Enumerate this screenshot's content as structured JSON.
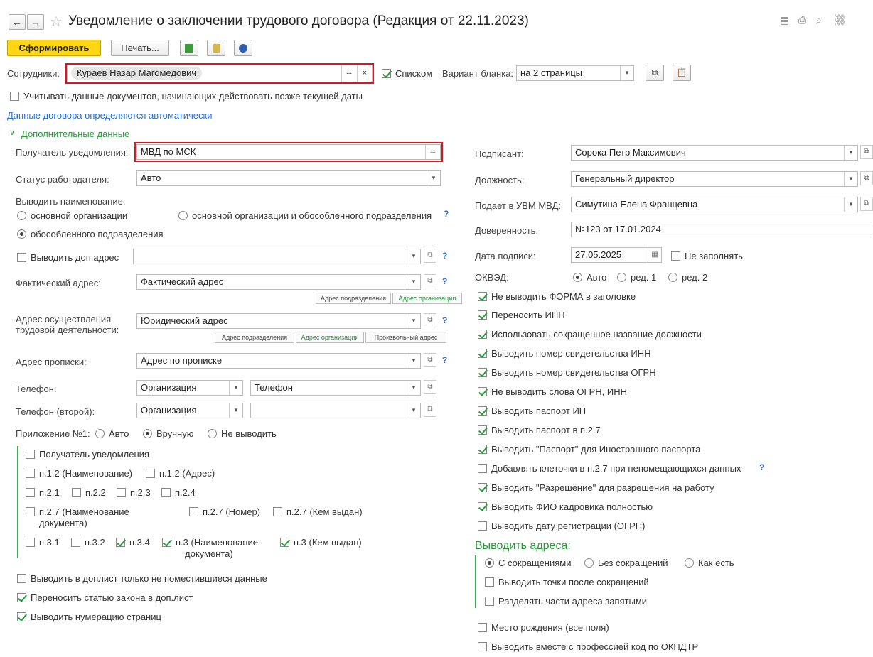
{
  "window": {
    "title": "Уведомление о заключении трудового договора (Редакция от 22.11.2023)"
  },
  "toolbar": {
    "generate_label": "Сформировать",
    "print_label": "Печать..."
  },
  "employees": {
    "label": "Сотрудники:",
    "value": "Кураев Назар Магомедович",
    "list_label": "Списком",
    "variant_label": "Вариант бланка:",
    "variant_value": "на 2 страницы"
  },
  "options": {
    "future_docs_label": "Учитывать данные документов, начинающих действовать позже текущей даты",
    "auto_link": "Данные договора определяются автоматически",
    "additional_section": "Дополнительные данные"
  },
  "left": {
    "recipient_label": "Получатель уведомления:",
    "recipient_value": "МВД по МСК",
    "employer_status_label": "Статус работодателя:",
    "employer_status_value": "Авто",
    "output_name_label": "Выводить наименование:",
    "radio_main_org": "основной организации",
    "radio_main_and_sub": "основной организации и обособленного подразделения",
    "radio_sub": "обособленного подразделения",
    "extra_address_label": "Выводить доп.адрес",
    "actual_address_label": "Фактический адрес:",
    "actual_address_value": "Фактический адрес",
    "btn_sub_address": "Адрес подразделения",
    "btn_org_address": "Адрес организации",
    "work_address_label_1": "Адрес осуществления",
    "work_address_label_2": "трудовой деятельности:",
    "work_address_value": "Юридический адрес",
    "btn_custom_address": "Произвольный адрес",
    "reg_address_label": "Адрес прописки:",
    "reg_address_value": "Адрес по прописке",
    "phone_label": "Телефон:",
    "phone_source": "Организация",
    "phone_value": "Телефон",
    "phone2_label": "Телефон (второй):",
    "phone2_source": "Организация",
    "phone2_value": "",
    "appendix_label": "Приложение №1:",
    "appendix_auto": "Авто",
    "appendix_manual": "Вручную",
    "appendix_none": "Не выводить",
    "app_recipient": "Получатель уведомления",
    "p12_name": "п.1.2 (Наименование)",
    "p12_addr": "п.1.2 (Адрес)",
    "p21": "п.2.1",
    "p22": "п.2.2",
    "p23": "п.2.3",
    "p24": "п.2.4",
    "p27_name_1": "п.2.7 (Наименование",
    "p27_name_2": "документа)",
    "p27_num": "п.2.7 (Номер)",
    "p27_issued": "п.2.7 (Кем выдан)",
    "p31": "п.3.1",
    "p32": "п.3.2",
    "p34": "п.3.4",
    "p3_name_1": "п.3 (Наименование",
    "p3_name_2": "документа)",
    "p3_issued": "п.3 (Кем выдан)",
    "extra_only_overflow": "Выводить в доплист только не поместившиеся данные",
    "move_law_article": "Переносить статью закона в доп.лист",
    "page_numbering": "Выводить нумерацию страниц"
  },
  "right": {
    "signer_label": "Подписант:",
    "signer_value": "Сорока Петр Максимович",
    "position_label": "Должность:",
    "position_value": "Генеральный директор",
    "uvm_label": "Подает в УВМ МВД:",
    "uvm_value": "Симутина Елена Францевна",
    "power_label": "Доверенность:",
    "power_value": "№123 от 17.01.2024",
    "sign_date_label": "Дата подписи:",
    "sign_date_value": "27.05.2025",
    "no_fill_label": "Не заполнять",
    "okved_label": "ОКВЭД:",
    "okved_auto": "Авто",
    "okved_red1": "ред. 1",
    "okved_red2": "ред. 2",
    "checks": [
      "Не выводить ФОРМА в заголовке",
      "Переносить ИНН",
      "Использовать сокращенное название должности",
      "Выводить номер свидетельства ИНН",
      "Выводить номер свидетельства ОГРН",
      "Не выводить слова ОГРН, ИНН",
      "Выводить паспорт ИП",
      "Выводить паспорт в п.2.7",
      "Выводить \"Паспорт\" для Иностранного паспорта",
      "Добавлять клеточки в п.2.7 при непомещающихся данных",
      "Выводить \"Разрешение\" для разрешения на работу",
      "Выводить ФИО кадровика полностью",
      "Выводить дату регистрации (ОГРН)"
    ],
    "addresses_header": "Выводить адреса:",
    "addr_with_abbr": "С сокращениями",
    "addr_without_abbr": "Без сокращений",
    "addr_as_is": "Как есть",
    "addr_dots": "Выводить точки после сокращений",
    "addr_commas": "Разделять части адреса запятыми",
    "birth_place": "Место рождения (все поля)",
    "okpdtr": "Выводить вместе с профессией код по ОКПДТР"
  }
}
